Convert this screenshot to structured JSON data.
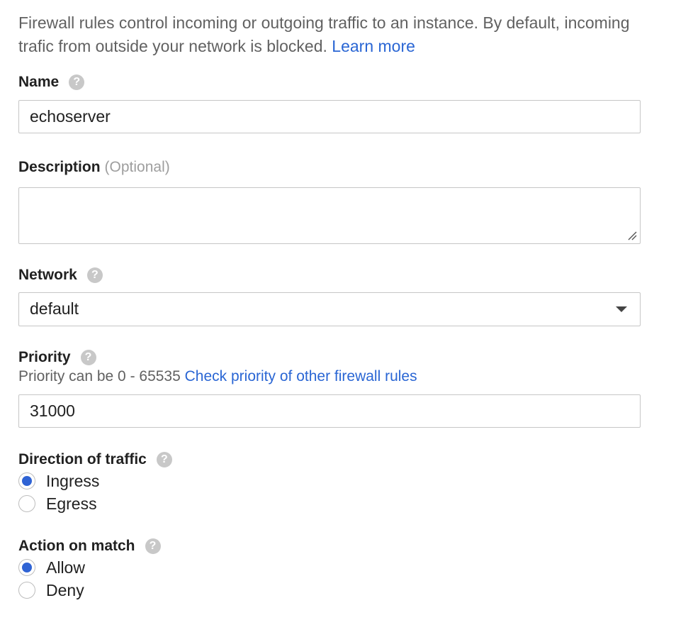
{
  "intro": {
    "text": "Firewall rules control incoming or outgoing traffic to an instance. By default, incoming trafic from outside your network is blocked.",
    "link": "Learn more"
  },
  "name": {
    "label": "Name",
    "value": "echoserver"
  },
  "description": {
    "label": "Description",
    "optional": "(Optional)",
    "value": ""
  },
  "network": {
    "label": "Network",
    "selected": "default"
  },
  "priority": {
    "label": "Priority",
    "hint": "Priority can be 0 - 65535",
    "link": "Check priority of other firewall rules",
    "value": "31000"
  },
  "direction": {
    "label": "Direction of traffic",
    "options": [
      {
        "label": "Ingress",
        "selected": true
      },
      {
        "label": "Egress",
        "selected": false
      }
    ]
  },
  "action": {
    "label": "Action on match",
    "options": [
      {
        "label": "Allow",
        "selected": true
      },
      {
        "label": "Deny",
        "selected": false
      }
    ]
  },
  "icons": {
    "help": "?"
  },
  "colors": {
    "link": "#2a66d4",
    "radio_selected": "#2f63d4",
    "help_icon": "#c8c8c8",
    "border": "#c6c6c6"
  }
}
